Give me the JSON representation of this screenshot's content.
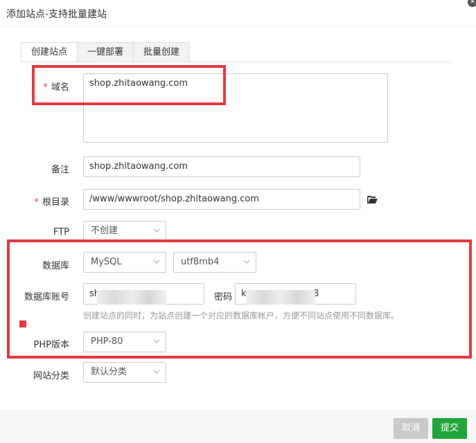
{
  "dialog": {
    "title": "添加站点-支持批量建站",
    "close_glyph": "✕"
  },
  "tabs": [
    {
      "label": "创建站点",
      "active": true
    },
    {
      "label": "一键部署",
      "active": false
    },
    {
      "label": "批量创建",
      "active": false
    }
  ],
  "form": {
    "domain": {
      "label": "域名",
      "required_mark": "*",
      "value": "shop.zhitaowang.com"
    },
    "remark": {
      "label": "备注",
      "value": "shop.zhitaowang.com"
    },
    "root_dir": {
      "label": "根目录",
      "required_mark": "*",
      "value": "/www/wwwroot/shop.zhitaowang.com"
    },
    "ftp": {
      "label": "FTP",
      "selected": "不创建"
    },
    "database": {
      "label": "数据库",
      "type_selected": "MySQL",
      "charset_selected": "utf8mb4"
    },
    "db_account": {
      "label": "数据库账号",
      "value_visible": "sh",
      "password_label": "密码",
      "password_visible_start": "k",
      "password_visible_end": "8"
    },
    "db_hint": "创建站点的同时，为站点创建一个对应的数据库帐户，方便不同站点使用不同数据库。",
    "php_version": {
      "label": "PHP版本",
      "selected": "PHP-80"
    },
    "site_category": {
      "label": "网站分类",
      "selected": "默认分类"
    }
  },
  "footer": {
    "cancel_label": "取消",
    "submit_label": "提交"
  },
  "colors": {
    "highlight": "#e8373f",
    "primary": "#20a53a",
    "disabled": "#c9c9c9"
  },
  "icons": {
    "folder": "folder-open-icon",
    "close": "close-icon"
  }
}
